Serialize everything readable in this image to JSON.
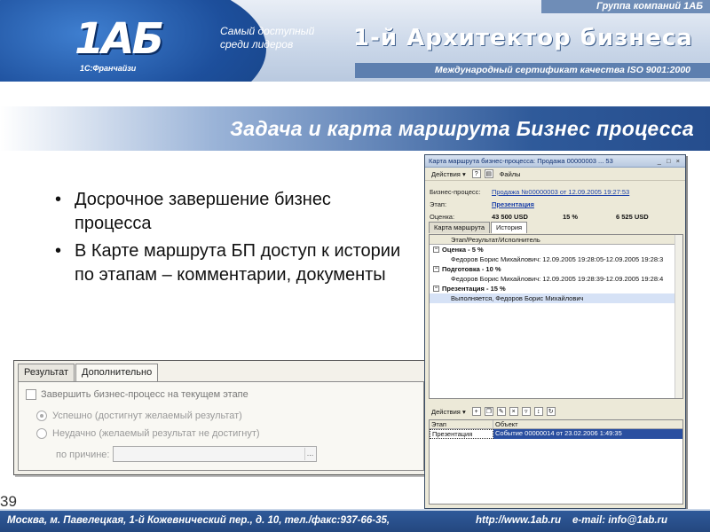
{
  "banner": {
    "group_name": "Группа компаний 1АБ",
    "logo_text": "1АБ",
    "franchise": "1С:Франчайзи",
    "slogan": "Самый доступный среди лидеров",
    "brand": "1-й Архитектор бизнеса",
    "iso": "Международный сертификат качества ISO 9001:2000"
  },
  "title": "Задача и карта маршрута Бизнес процесса",
  "bullets": [
    "Досрочное завершение бизнес процесса",
    "В Карте маршрута БП доступ к истории по этапам – комментарии, документы"
  ],
  "dialog": {
    "tabs": [
      "Результат",
      "Дополнительно"
    ],
    "checkbox_label": "Завершить бизнес-процесс на текущем этапе",
    "radio_success": "Успешно (достигнут желаемый результат)",
    "radio_fail": "Неудачно (желаемый результат не достигнут)",
    "reason_label": "по причине:",
    "ellipsis": "..."
  },
  "window": {
    "title": "Карта маршрута бизнес-процесса: Продажа 00000003 ... 53",
    "controls": "_ □ ×",
    "actions_label": "Действия ▾",
    "help_icon": "?",
    "files_label": "Файлы",
    "bp_label": "Бизнес-процесс:",
    "bp_value": "Продажа №00000003 от 12.09.2005 19:27:53",
    "stage_label": "Этап:",
    "stage_value": "Презентация",
    "score_label": "Оценка:",
    "score_amount": "43 500 USD",
    "score_pct": "15 %",
    "score_total": "6 525 USD",
    "tabs": [
      "Карта маршрута",
      "История"
    ],
    "tree_header": "Этап/Результат/Исполнитель",
    "tree_rows": [
      {
        "text": "Оценка - 5 %",
        "group": true
      },
      {
        "text": "Федоров Борис Михайлович: 12.09.2005 19:28:05-12.09.2005 19:28:3",
        "group": false
      },
      {
        "text": "Подготовка - 10 %",
        "group": true
      },
      {
        "text": "Федоров Борис Михайлович: 12.09.2005 19:28:39-12.09.2005 19:28:4",
        "group": false
      },
      {
        "text": "Презентация - 15 %",
        "group": true
      },
      {
        "text": "Выполняется, Федоров Борис Михайлович",
        "group": false
      }
    ],
    "actions2_label": "Действия ▾",
    "grid_headers": [
      "Этап",
      "Объект"
    ],
    "grid_rows": [
      {
        "stage": "Презентация",
        "object": "Событие 00000014 от 23.02.2006 1:49:35"
      }
    ]
  },
  "footer": {
    "address": "Москва, м. Павелецкая, 1-й Кожевнический пер., д. 10, тел./факс:937-66-35,",
    "url": "http://www.1ab.ru",
    "email": "e-mail: info@1ab.ru"
  },
  "slide_number": "39",
  "colors": {
    "brand_blue": "#2f5a9a",
    "link_blue": "#1a3fa8",
    "highlight": "#2a4fa0"
  }
}
